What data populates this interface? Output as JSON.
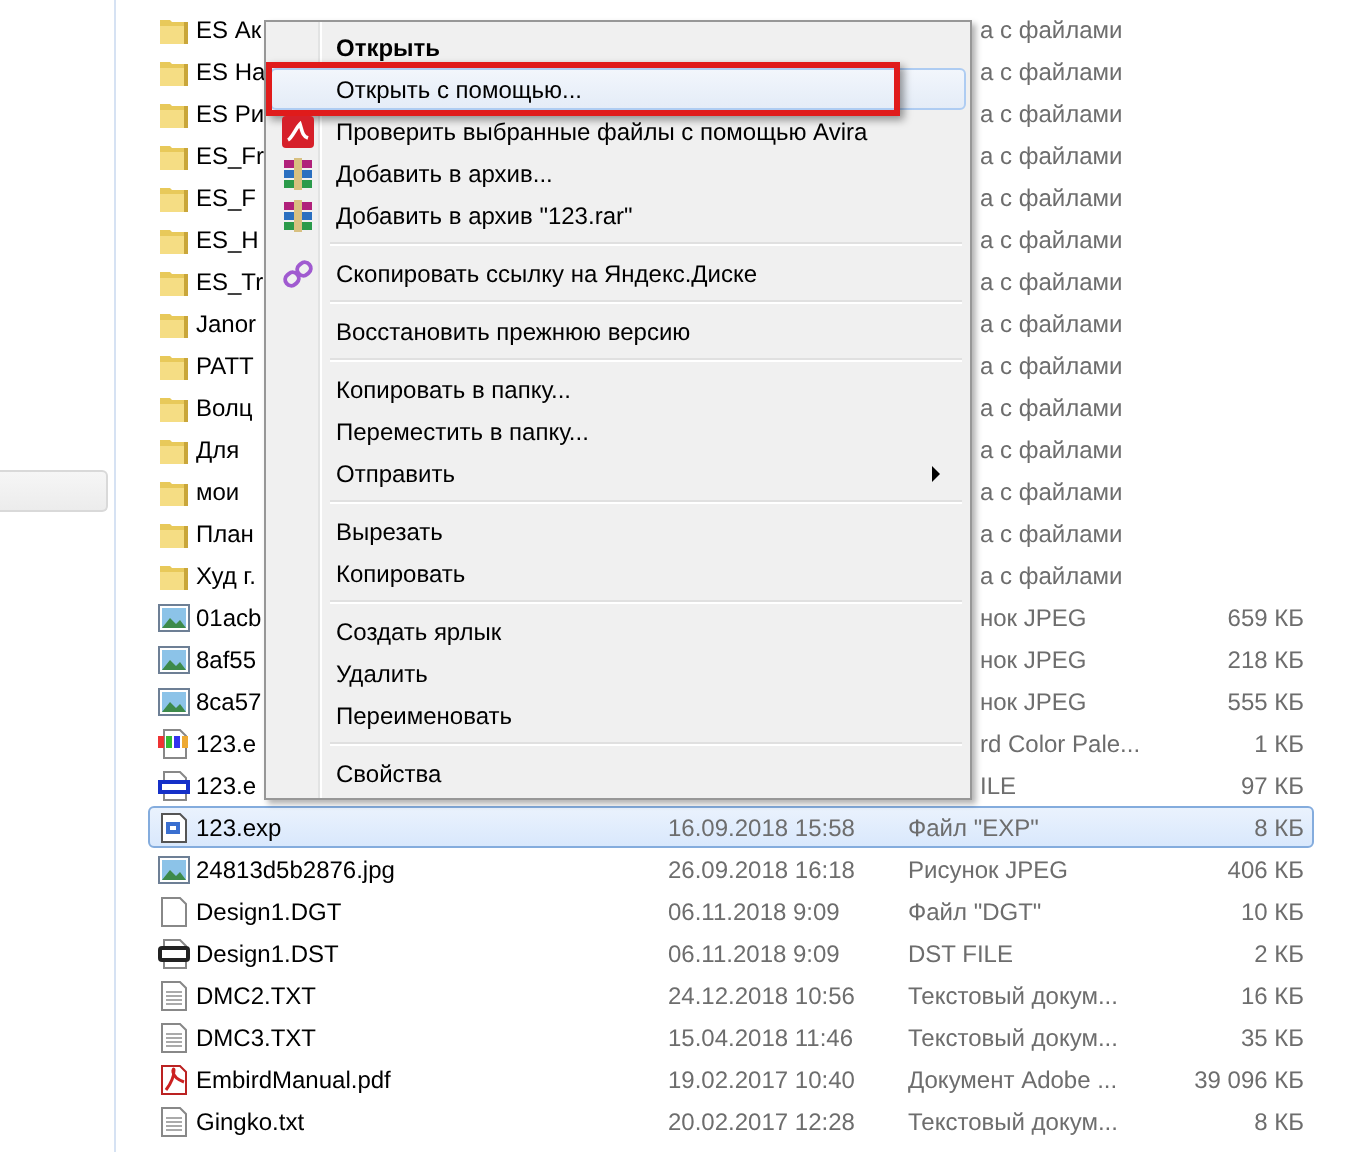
{
  "files": [
    {
      "kind": "folder",
      "name": "ES Ак",
      "type": "а с файлами",
      "selected": false
    },
    {
      "kind": "folder",
      "name": "ES На",
      "type": "а с файлами",
      "selected": false
    },
    {
      "kind": "folder",
      "name": "ES Ри",
      "type": "а с файлами",
      "selected": false
    },
    {
      "kind": "folder",
      "name": "ES_Fr",
      "type": "а с файлами",
      "selected": false
    },
    {
      "kind": "folder",
      "name": "ES_F",
      "type": "а с файлами",
      "selected": false
    },
    {
      "kind": "folder",
      "name": "ES_H",
      "type": "а с файлами",
      "selected": false
    },
    {
      "kind": "folder",
      "name": "ES_Tr",
      "type": "а с файлами",
      "selected": false
    },
    {
      "kind": "folder",
      "name": "Janor",
      "type": "а с файлами",
      "selected": false
    },
    {
      "kind": "folder",
      "name": "PATT",
      "type": "а с файлами",
      "selected": false
    },
    {
      "kind": "folder",
      "name": "Волц",
      "type": "а с файлами",
      "selected": false
    },
    {
      "kind": "folder",
      "name": "Для",
      "type": "а с файлами",
      "selected": false
    },
    {
      "kind": "folder",
      "name": "мои",
      "type": "а с файлами",
      "selected": false
    },
    {
      "kind": "folder",
      "name": "План",
      "type": "а с файлами",
      "selected": false
    },
    {
      "kind": "folder",
      "name": "Худ г.",
      "type": "а с файлами",
      "selected": false
    },
    {
      "kind": "image",
      "name": "01acb",
      "type": "нок JPEG",
      "size": "659 КБ",
      "selected": false
    },
    {
      "kind": "image",
      "name": "8af55",
      "type": "нок JPEG",
      "size": "218 КБ",
      "selected": false
    },
    {
      "kind": "image",
      "name": "8ca57",
      "type": "нок JPEG",
      "size": "555 КБ",
      "selected": false
    },
    {
      "kind": "palette",
      "name": "123.e",
      "type": "rd Color Pale...",
      "size": "1 КБ",
      "selected": false
    },
    {
      "kind": "eof",
      "name": "123.e",
      "type": "ILE",
      "size": "97 КБ",
      "selected": false
    },
    {
      "kind": "exp",
      "name": "123.exp",
      "date": "16.09.2018 15:58",
      "type": "Файл \"EXP\"",
      "size": "8 КБ",
      "selected": true
    },
    {
      "kind": "image",
      "name": "24813d5b2876.jpg",
      "date": "26.09.2018 16:18",
      "type": "Рисунок JPEG",
      "size": "406 КБ",
      "selected": false
    },
    {
      "kind": "blank",
      "name": "Design1.DGT",
      "date": "06.11.2018 9:09",
      "type": "Файл \"DGT\"",
      "size": "10 КБ",
      "selected": false
    },
    {
      "kind": "dst",
      "name": "Design1.DST",
      "date": "06.11.2018 9:09",
      "type": "DST FILE",
      "size": "2 КБ",
      "selected": false
    },
    {
      "kind": "text",
      "name": "DMC2.TXT",
      "date": "24.12.2018 10:56",
      "type": "Текстовый докум...",
      "size": "16 КБ",
      "selected": false
    },
    {
      "kind": "text",
      "name": "DMC3.TXT",
      "date": "15.04.2018 11:46",
      "type": "Текстовый докум...",
      "size": "35 КБ",
      "selected": false
    },
    {
      "kind": "pdf",
      "name": "EmbirdManual.pdf",
      "date": "19.02.2017 10:40",
      "type": "Документ Adobe ...",
      "size": "39 096 КБ",
      "selected": false
    },
    {
      "kind": "text",
      "name": "Gingko.txt",
      "date": "20.02.2017 12:28",
      "type": "Текстовый докум...",
      "size": "8 КБ",
      "selected": false
    }
  ],
  "context_menu": [
    {
      "kind": "plain",
      "label": "Открыть",
      "default": true,
      "highlighted": false,
      "annotated": false,
      "submenu": false
    },
    {
      "kind": "plain",
      "label": "Открыть с помощью...",
      "default": false,
      "highlighted": true,
      "annotated": true,
      "submenu": false
    },
    {
      "kind": "avira",
      "label": "Проверить выбранные файлы с помощью Avira",
      "default": false,
      "highlighted": false,
      "annotated": false,
      "submenu": false
    },
    {
      "kind": "archive",
      "label": "Добавить в архив...",
      "default": false,
      "highlighted": false,
      "annotated": false,
      "submenu": false
    },
    {
      "kind": "archive",
      "label": "Добавить в архив \"123.rar\"",
      "default": false,
      "highlighted": false,
      "annotated": false,
      "submenu": false
    },
    {
      "kind": "separator"
    },
    {
      "kind": "link",
      "label": "Скопировать ссылку на Яндекс.Диске",
      "default": false,
      "highlighted": false,
      "annotated": false,
      "submenu": false
    },
    {
      "kind": "separator"
    },
    {
      "kind": "plain",
      "label": "Восстановить прежнюю версию",
      "default": false,
      "highlighted": false,
      "annotated": false,
      "submenu": false
    },
    {
      "kind": "separator"
    },
    {
      "kind": "plain",
      "label": "Копировать в папку...",
      "default": false,
      "highlighted": false,
      "annotated": false,
      "submenu": false
    },
    {
      "kind": "plain",
      "label": "Переместить в папку...",
      "default": false,
      "highlighted": false,
      "annotated": false,
      "submenu": false
    },
    {
      "kind": "plain",
      "label": "Отправить",
      "default": false,
      "highlighted": false,
      "annotated": false,
      "submenu": true
    },
    {
      "kind": "separator"
    },
    {
      "kind": "plain",
      "label": "Вырезать",
      "default": false,
      "highlighted": false,
      "annotated": false,
      "submenu": false
    },
    {
      "kind": "plain",
      "label": "Копировать",
      "default": false,
      "highlighted": false,
      "annotated": false,
      "submenu": false
    },
    {
      "kind": "separator"
    },
    {
      "kind": "plain",
      "label": "Создать ярлык",
      "default": false,
      "highlighted": false,
      "annotated": false,
      "submenu": false
    },
    {
      "kind": "plain",
      "label": "Удалить",
      "default": false,
      "highlighted": false,
      "annotated": false,
      "submenu": false
    },
    {
      "kind": "plain",
      "label": "Переименовать",
      "default": false,
      "highlighted": false,
      "annotated": false,
      "submenu": false
    },
    {
      "kind": "separator"
    },
    {
      "kind": "plain",
      "label": "Свойства",
      "default": false,
      "highlighted": false,
      "annotated": false,
      "submenu": false
    }
  ]
}
